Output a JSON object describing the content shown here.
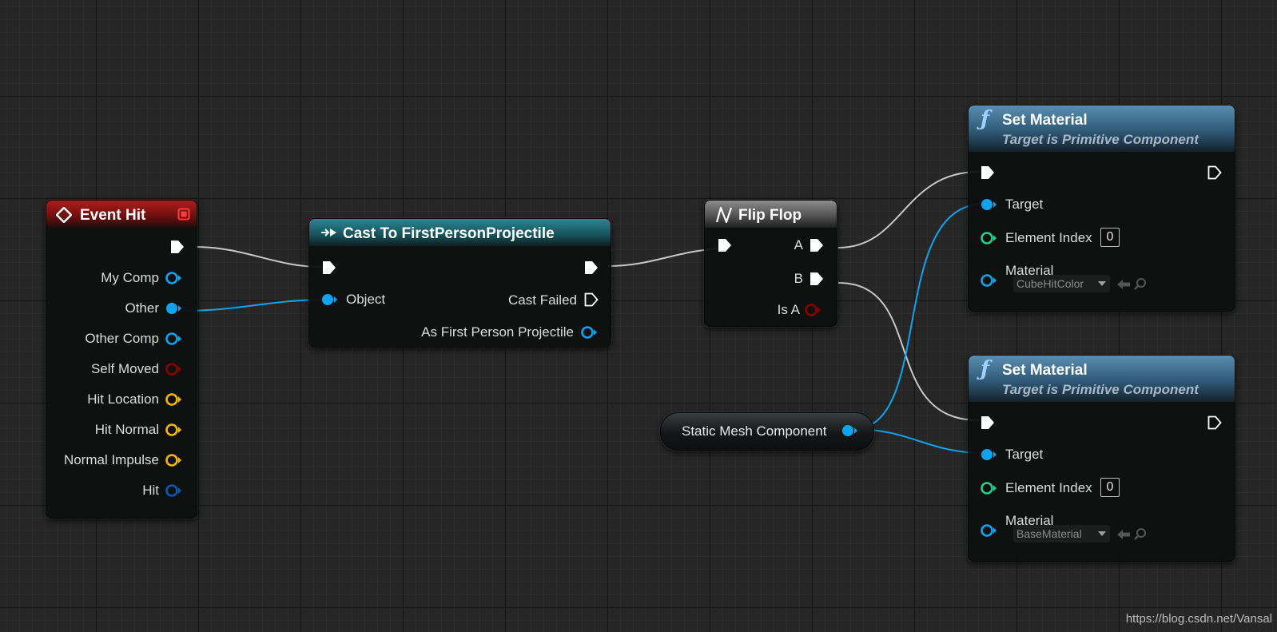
{
  "nodes": {
    "event_hit": {
      "title": "Event Hit",
      "pins": [
        "My Comp",
        "Other",
        "Other Comp",
        "Self Moved",
        "Hit Location",
        "Hit Normal",
        "Normal Impulse",
        "Hit"
      ]
    },
    "cast": {
      "title": "Cast To FirstPersonProjectile",
      "object_label": "Object",
      "cast_failed_label": "Cast Failed",
      "as_label": "As First Person Projectile"
    },
    "flip_flop": {
      "title": "Flip Flop",
      "a_label": "A",
      "b_label": "B",
      "is_a_label": "Is A"
    },
    "static_mesh": {
      "label": "Static Mesh Component"
    },
    "set_material_1": {
      "title": "Set Material",
      "subtitle": "Target is Primitive Component",
      "target_label": "Target",
      "element_index_label": "Element Index",
      "element_index_value": "0",
      "material_label": "Material",
      "material_value": "CubeHitColor"
    },
    "set_material_2": {
      "title": "Set Material",
      "subtitle": "Target is Primitive Component",
      "target_label": "Target",
      "element_index_label": "Element Index",
      "element_index_value": "0",
      "material_label": "Material",
      "material_value": "BaseMaterial"
    }
  },
  "watermark": "https://blog.csdn.net/Vansal",
  "colors": {
    "exec": "#ffffff",
    "object_pin": "#0fa4f0",
    "bool_pin": "#8c0000",
    "vector_pin": "#f5b800",
    "struct_pin": "#0a5ab4",
    "int_pin": "#20d08f",
    "event_header": "#9e1414",
    "cast_header": "#1e6b74",
    "flipflop_header": "#7a7a7a",
    "function_header": "#4a7795"
  }
}
